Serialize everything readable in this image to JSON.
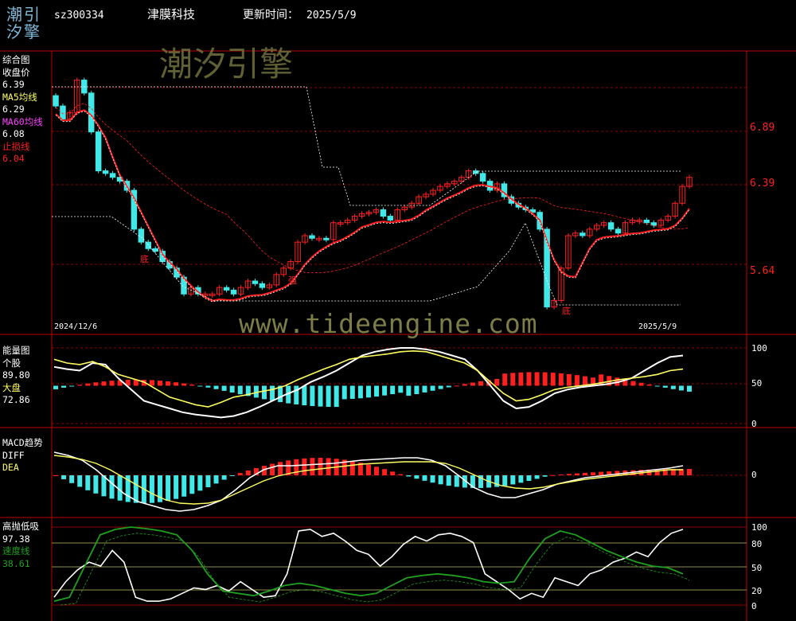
{
  "header": {
    "logo_top": "潮引",
    "logo_bottom": "汐擎",
    "code": "sz300334",
    "name": "津膜科技",
    "update_label": "更新时间：",
    "update_date": "2025/5/9"
  },
  "watermarks": {
    "brand": "潮汐引擎",
    "url": "www.tideengine.com"
  },
  "colors": {
    "up": "#ff2020",
    "down": "#40e8e8",
    "ma5": "#ffff60",
    "ma60": "#ff2020",
    "grid": "#c00000",
    "white_line": "#ffffff",
    "green_line": "#1fa01f"
  },
  "panels": {
    "main": {
      "labels": [
        {
          "text": "综合图",
          "color": "#ffffff"
        },
        {
          "text": "收盘价",
          "color": "#ffffff"
        },
        {
          "text": "6.39",
          "color": "#ffffff"
        },
        {
          "text": "MA5均线",
          "color": "#ffff60"
        },
        {
          "text": "6.29",
          "color": "#ffffff"
        },
        {
          "text": "MA60均线",
          "color": "#ff40ff"
        },
        {
          "text": "6.08",
          "color": "#ffffff"
        },
        {
          "text": "止损线",
          "color": "#ff2020"
        },
        {
          "text": "6.04",
          "color": "#ff2020"
        }
      ],
      "date_start": "2024/12/6",
      "date_end": "2025/5/9",
      "annotations": [
        "底",
        "强",
        "底"
      ]
    },
    "energy": {
      "labels": [
        {
          "text": "能量图",
          "color": "#ffffff"
        },
        {
          "text": "个股",
          "color": "#ffffff"
        },
        {
          "text": "89.80",
          "color": "#ffffff"
        },
        {
          "text": "大盘",
          "color": "#ffff60"
        },
        {
          "text": "72.86",
          "color": "#ffffff"
        }
      ]
    },
    "macd": {
      "labels": [
        {
          "text": "MACD趋势",
          "color": "#ffffff"
        },
        {
          "text": "DIFF",
          "color": "#ffffff"
        },
        {
          "text": "DEA",
          "color": "#ffff60"
        }
      ]
    },
    "hilo": {
      "labels": [
        {
          "text": "高抛低吸",
          "color": "#ffffff"
        },
        {
          "text": "97.38",
          "color": "#ffffff"
        },
        {
          "text": "速度线",
          "color": "#1fa01f"
        },
        {
          "text": "38.61",
          "color": "#1fa01f"
        }
      ]
    }
  },
  "chart_data": [
    {
      "type": "candlestick",
      "panel": "综合图",
      "x_range": [
        "2024/12/6",
        "2025/5/9"
      ],
      "ylim": [
        5.3,
        7.4
      ],
      "y_ticks": [
        "6.89",
        "6.39",
        "5.64"
      ],
      "series": [
        {
          "name": "收盘价",
          "close": [
            7.0,
            6.9,
            6.95,
            7.2,
            7.1,
            6.8,
            6.5,
            6.48,
            6.45,
            6.42,
            6.35,
            6.05,
            5.95,
            5.9,
            5.88,
            5.8,
            5.75,
            5.68,
            5.55,
            5.6,
            5.55,
            5.55,
            5.55,
            5.6,
            5.58,
            5.55,
            5.6,
            5.65,
            5.63,
            5.6,
            5.62,
            5.7,
            5.75,
            5.8,
            5.95,
            6.0,
            5.98,
            5.98,
            5.97,
            6.1,
            6.1,
            6.12,
            6.15,
            6.17,
            6.18,
            6.2,
            6.15,
            6.12,
            6.2,
            6.22,
            6.25,
            6.3,
            6.32,
            6.35,
            6.38,
            6.4,
            6.42,
            6.45,
            6.5,
            6.48,
            6.42,
            6.35,
            6.4,
            6.3,
            6.25,
            6.22,
            6.2,
            6.18,
            6.05,
            5.45,
            5.5,
            5.75,
            6.0,
            6.02,
            6.0,
            6.05,
            6.08,
            6.1,
            6.05,
            6.02,
            6.1,
            6.12,
            6.12,
            6.1,
            6.08,
            6.12,
            6.15,
            6.25,
            6.38,
            6.45
          ]
        },
        {
          "name": "MA5均线",
          "last": 6.29
        },
        {
          "name": "MA60均线",
          "last": 6.08
        },
        {
          "name": "止损线",
          "last": 6.04
        }
      ]
    },
    {
      "type": "line",
      "panel": "能量图",
      "ylim": [
        0,
        100
      ],
      "y_ticks": [
        "100",
        "50",
        "0"
      ],
      "series": [
        {
          "name": "个股",
          "last": 89.8
        },
        {
          "name": "大盘",
          "last": 72.86
        }
      ]
    },
    {
      "type": "line",
      "panel": "MACD趋势",
      "y_ticks": [
        "0"
      ],
      "series": [
        {
          "name": "DIFF"
        },
        {
          "name": "DEA"
        }
      ]
    },
    {
      "type": "line",
      "panel": "高抛低吸",
      "ylim": [
        0,
        100
      ],
      "y_ticks": [
        "100",
        "80",
        "50",
        "20",
        "0"
      ],
      "series": [
        {
          "name": "高抛低吸",
          "last": 97.38
        },
        {
          "name": "速度线",
          "last": 38.61
        }
      ]
    }
  ]
}
